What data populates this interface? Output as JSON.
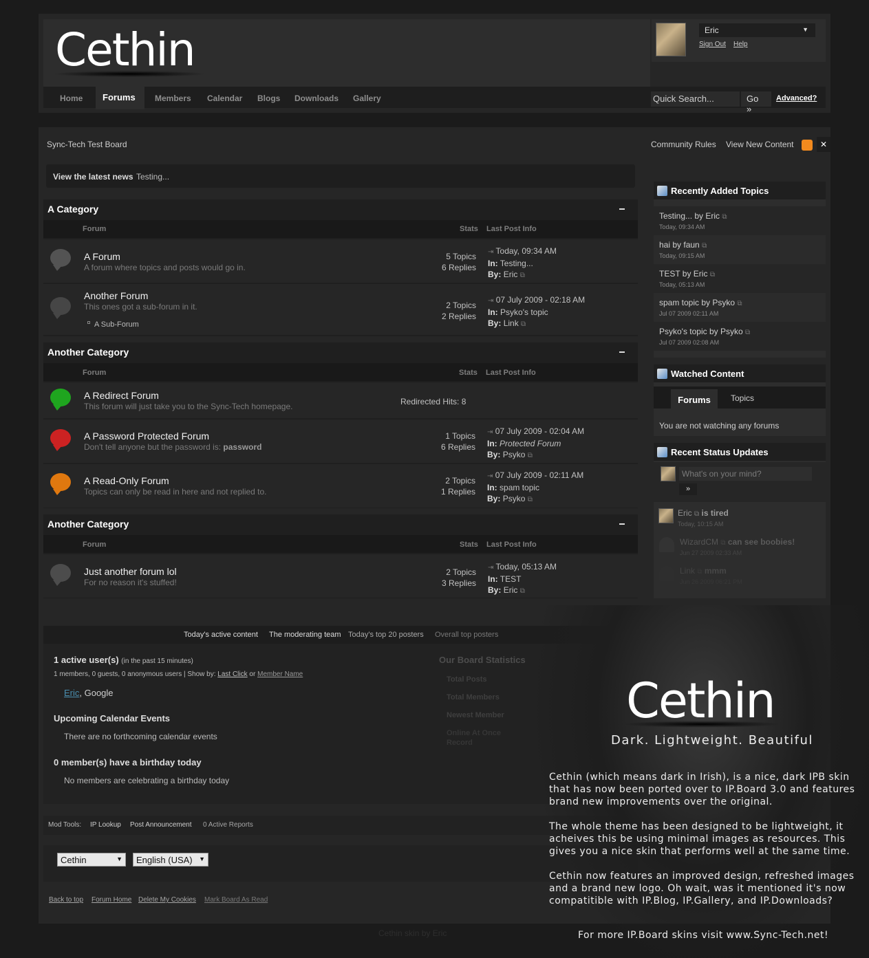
{
  "brand": {
    "logo": "Cethin"
  },
  "user": {
    "name": "Eric",
    "sign_out": "Sign Out",
    "help": "Help"
  },
  "nav": {
    "items": [
      "Home",
      "Forums",
      "Members",
      "Calendar",
      "Blogs",
      "Downloads",
      "Gallery"
    ],
    "active": "Forums"
  },
  "search": {
    "placeholder": "Quick Search...",
    "go": "Go »",
    "advanced": "Advanced?"
  },
  "breadcrumb": {
    "board": "Sync-Tech Test Board",
    "rules": "Community Rules",
    "new_content": "View New Content"
  },
  "news": {
    "label": "View the latest news",
    "text": "Testing..."
  },
  "headers": {
    "forum": "Forum",
    "stats": "Stats",
    "last": "Last Post Info"
  },
  "categories": [
    {
      "title": "A Category",
      "forums": [
        {
          "name": "A Forum",
          "desc": "A forum where topics and posts would go in.",
          "topics": "5 Topics",
          "replies": "6 Replies",
          "date": "Today, 09:34 AM",
          "in_label": "In:",
          "in": "Testing...",
          "by_label": "By:",
          "by": "Eric"
        },
        {
          "name": "Another Forum",
          "desc": "This ones got a sub-forum in it.",
          "sub": "A Sub-Forum",
          "topics": "2 Topics",
          "replies": "2 Replies",
          "date": "07 July 2009 - 02:18 AM",
          "in_label": "In:",
          "in": "Psyko's topic",
          "by_label": "By:",
          "by": "Link"
        }
      ]
    },
    {
      "title": "Another Category",
      "forums": [
        {
          "name": "A Redirect Forum",
          "desc": "This forum will just take you to the Sync-Tech homepage.",
          "redirect": "Redirected Hits: 8"
        },
        {
          "name": "A Password Protected Forum",
          "desc": "Don't tell anyone but the password is:",
          "desc_strong": "password",
          "topics": "1 Topics",
          "replies": "6 Replies",
          "date": "07 July 2009 - 02:04 AM",
          "in_label": "In:",
          "in": "Protected Forum",
          "by_label": "By:",
          "by": "Psyko"
        },
        {
          "name": "A Read-Only Forum",
          "desc": "Topics can only be read in here and not replied to.",
          "topics": "2 Topics",
          "replies": "1 Replies",
          "date": "07 July 2009 - 02:11 AM",
          "in_label": "In:",
          "in": "spam topic",
          "by_label": "By:",
          "by": "Psyko"
        }
      ]
    },
    {
      "title": "Another Category",
      "forums": [
        {
          "name": "Just another forum lol",
          "desc": "For no reason it's stuffed!",
          "topics": "2 Topics",
          "replies": "3 Replies",
          "date": "Today, 05:13 AM",
          "in_label": "In:",
          "in": "TEST",
          "by_label": "By:",
          "by": "Eric"
        }
      ]
    }
  ],
  "recent_topics": {
    "title": "Recently Added Topics",
    "items": [
      {
        "topic": "Testing...",
        "by": "by Eric",
        "date": "Today, 09:34 AM"
      },
      {
        "topic": "hai",
        "by": "by faun",
        "date": "Today, 09:15 AM"
      },
      {
        "topic": "TEST",
        "by": "by Eric",
        "date": "Today, 05:13 AM"
      },
      {
        "topic": "spam topic",
        "by": "by Psyko",
        "date": "Jul 07 2009 02:11 AM"
      },
      {
        "topic": "Psyko's topic",
        "by": "by Psyko",
        "date": "Jul 07 2009 02:08 AM"
      }
    ]
  },
  "watched": {
    "title": "Watched Content",
    "tab_forums": "Forums",
    "tab_topics": "Topics",
    "empty": "You are not watching any forums"
  },
  "status": {
    "title": "Recent Status Updates",
    "placeholder": "What's on your mind?",
    "submit": "»",
    "items": [
      {
        "user": "Eric",
        "text": "is tired",
        "date": "Today, 10:15 AM"
      },
      {
        "user": "WizardCM",
        "text": "can see boobies!",
        "date": "Jun 27 2009 02:33 AM"
      },
      {
        "user": "Link",
        "text": "mmm",
        "date": "Jun 26 2009 06:21 PM"
      }
    ]
  },
  "stats": {
    "tabs": [
      "Today's active content",
      "The moderating team",
      "Today's top 20 posters",
      "Overall top posters"
    ],
    "active_title": "1 active user(s)",
    "active_sub": "(in the past 15 minutes)",
    "active_detail": "1 members, 0 guests, 0 anonymous users | Show by:",
    "show_last": "Last Click",
    "show_or": "or",
    "show_name": "Member Name",
    "online_user": "Eric",
    "online_bot": ", Google",
    "calendar_title": "Upcoming Calendar Events",
    "calendar_text": "There are no forthcoming calendar events",
    "birthday_title": "0 member(s) have a birthday today",
    "birthday_text": "No members are celebrating a birthday today",
    "board_stats": "Our Board Statistics",
    "bs_rows": [
      "Total Posts",
      "Total Members",
      "Newest Member",
      "Online At Once",
      "Record"
    ]
  },
  "mod_tools": {
    "label": "Mod Tools:",
    "items": [
      "IP Lookup",
      "Post Announcement",
      "0 Active Reports"
    ]
  },
  "selects": {
    "skin": "Cethin",
    "language": "English (USA)"
  },
  "footer": {
    "links": [
      "Back to top",
      "Forum Home",
      "Delete My Cookies",
      "Mark Board As Read"
    ],
    "credit": "Cethin skin by Eric"
  },
  "promo": {
    "logo": "Cethin",
    "tagline": "Dark. Lightweight. Beautiful",
    "p1": "Cethin (which means dark in Irish), is a nice, dark IPB skin that has now been ported over to IP.Board 3.0 and features brand new improvements over the original.",
    "p2": "The whole theme has been designed to be lightweight, it acheives this be using minimal images as resources. This gives you a nice skin that performs well at the same time.",
    "p3": "Cethin now features an improved design, refreshed images and a brand new logo. Oh wait, was it mentioned it's now compatitible with IP.Blog, IP.Gallery, and IP.Downloads?",
    "footer": "For more IP.Board skins visit www.Sync-Tech.net!"
  },
  "colors": {
    "accent_red": "#cc2222",
    "accent_green": "#22aa22",
    "accent_orange": "#e0780f",
    "rss": "#f28a1e"
  }
}
